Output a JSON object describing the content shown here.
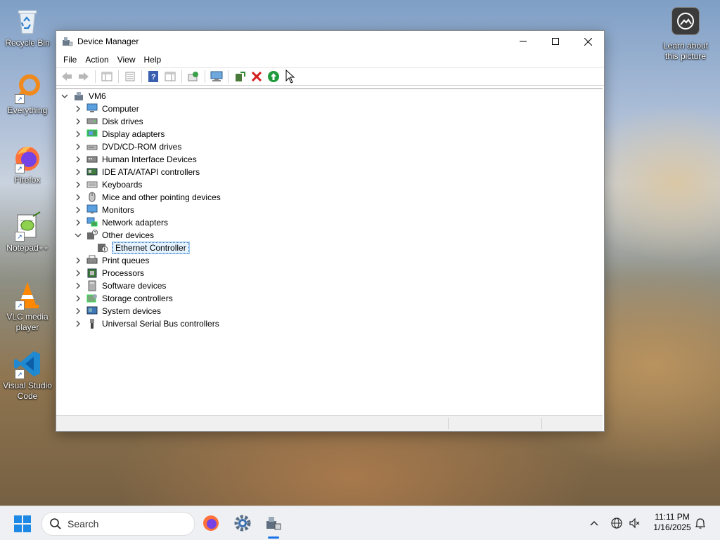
{
  "desktop": {
    "icons": [
      {
        "label": "Recycle Bin"
      },
      {
        "label": "Everything"
      },
      {
        "label": "Firefox"
      },
      {
        "label": "Notepad++"
      },
      {
        "label": "VLC media player"
      },
      {
        "label": "Visual Studio Code"
      }
    ],
    "learn_label": "Learn about this picture"
  },
  "window": {
    "title": "Device Manager",
    "menu": [
      "File",
      "Action",
      "View",
      "Help"
    ],
    "toolbar_icons": [
      "back-arrow-icon",
      "forward-arrow-icon",
      "show-hide-tree-icon",
      "properties-icon",
      "help-icon",
      "action-pane-icon",
      "update-driver-icon",
      "scan-hardware-icon",
      "add-legacy-hardware-icon",
      "uninstall-device-icon",
      "enable-device-icon"
    ],
    "tree": {
      "root": "VM6",
      "categories": [
        {
          "label": "Computer",
          "icon": "computer-icon",
          "expanded": false
        },
        {
          "label": "Disk drives",
          "icon": "disk-drive-icon",
          "expanded": false
        },
        {
          "label": "Display adapters",
          "icon": "display-adapter-icon",
          "expanded": false
        },
        {
          "label": "DVD/CD-ROM drives",
          "icon": "dvd-drive-icon",
          "expanded": false
        },
        {
          "label": "Human Interface Devices",
          "icon": "hid-icon",
          "expanded": false
        },
        {
          "label": "IDE ATA/ATAPI controllers",
          "icon": "ide-controller-icon",
          "expanded": false
        },
        {
          "label": "Keyboards",
          "icon": "keyboard-icon",
          "expanded": false
        },
        {
          "label": "Mice and other pointing devices",
          "icon": "mouse-icon",
          "expanded": false
        },
        {
          "label": "Monitors",
          "icon": "monitor-icon",
          "expanded": false
        },
        {
          "label": "Network adapters",
          "icon": "network-adapter-icon",
          "expanded": false
        },
        {
          "label": "Other devices",
          "icon": "unknown-device-icon",
          "expanded": true
        },
        {
          "label": "Ethernet Controller",
          "icon": "ethernet-warning-icon",
          "child": true,
          "selected": true
        },
        {
          "label": "Print queues",
          "icon": "printer-icon",
          "expanded": false
        },
        {
          "label": "Processors",
          "icon": "processor-icon",
          "expanded": false
        },
        {
          "label": "Software devices",
          "icon": "software-device-icon",
          "expanded": false
        },
        {
          "label": "Storage controllers",
          "icon": "storage-controller-icon",
          "expanded": false
        },
        {
          "label": "System devices",
          "icon": "system-device-icon",
          "expanded": false
        },
        {
          "label": "Universal Serial Bus controllers",
          "icon": "usb-icon",
          "expanded": false
        }
      ]
    }
  },
  "taskbar": {
    "search_placeholder": "Search",
    "time": "11:11 PM",
    "date": "1/16/2025",
    "apps": [
      "firefox-icon",
      "settings-icon",
      "device-manager-icon"
    ]
  },
  "colors": {
    "accent": "#1a73e8",
    "uninstall_red": "#d32020",
    "enable_green": "#1e9a3a"
  }
}
